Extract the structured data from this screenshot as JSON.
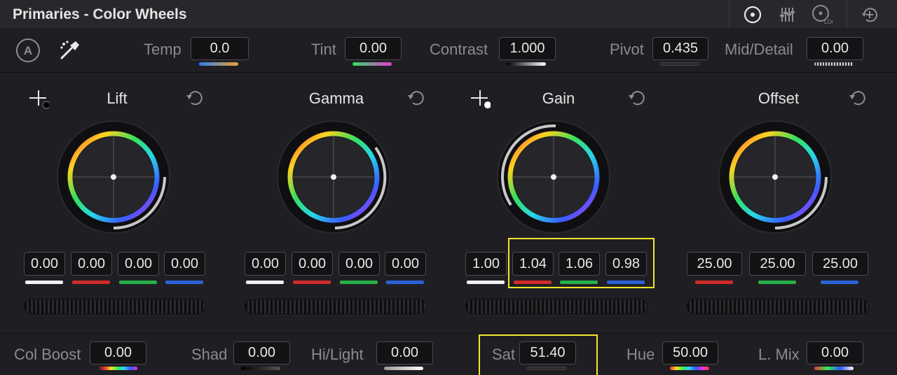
{
  "header": {
    "title": "Primaries - Color Wheels"
  },
  "top_controls": {
    "auto_label": "A",
    "temp": {
      "label": "Temp",
      "value": "0.0"
    },
    "tint": {
      "label": "Tint",
      "value": "0.00"
    },
    "contrast": {
      "label": "Contrast",
      "value": "1.000"
    },
    "pivot": {
      "label": "Pivot",
      "value": "0.435"
    },
    "mid_detail": {
      "label": "Mid/Detail",
      "value": "0.00"
    }
  },
  "wheels": [
    {
      "name": "Lift",
      "values": [
        "0.00",
        "0.00",
        "0.00",
        "0.00"
      ]
    },
    {
      "name": "Gamma",
      "values": [
        "0.00",
        "0.00",
        "0.00",
        "0.00"
      ]
    },
    {
      "name": "Gain",
      "values": [
        "1.00",
        "1.04",
        "1.06",
        "0.98"
      ]
    },
    {
      "name": "Offset",
      "values": [
        "25.00",
        "25.00",
        "25.00"
      ]
    }
  ],
  "bottom_controls": {
    "col_boost": {
      "label": "Col Boost",
      "value": "0.00"
    },
    "shad": {
      "label": "Shad",
      "value": "0.00"
    },
    "hi_light": {
      "label": "Hi/Light",
      "value": "0.00"
    },
    "sat": {
      "label": "Sat",
      "value": "51.40"
    },
    "hue": {
      "label": "Hue",
      "value": "50.00"
    },
    "l_mix": {
      "label": "L. Mix",
      "value": "0.00"
    }
  },
  "colors": {
    "highlight": "#f2e62b",
    "red_channel": "#d22a2a",
    "green_channel": "#27b04a",
    "blue_channel": "#2a62d6",
    "white_channel": "#f0f0f0"
  },
  "icons": [
    "color-wheels-icon",
    "bars-icon",
    "log-icon",
    "add-node-icon",
    "auto-balance-icon",
    "eyedropper-icon",
    "picker-black-icon",
    "picker-white-icon",
    "reset-icon"
  ]
}
